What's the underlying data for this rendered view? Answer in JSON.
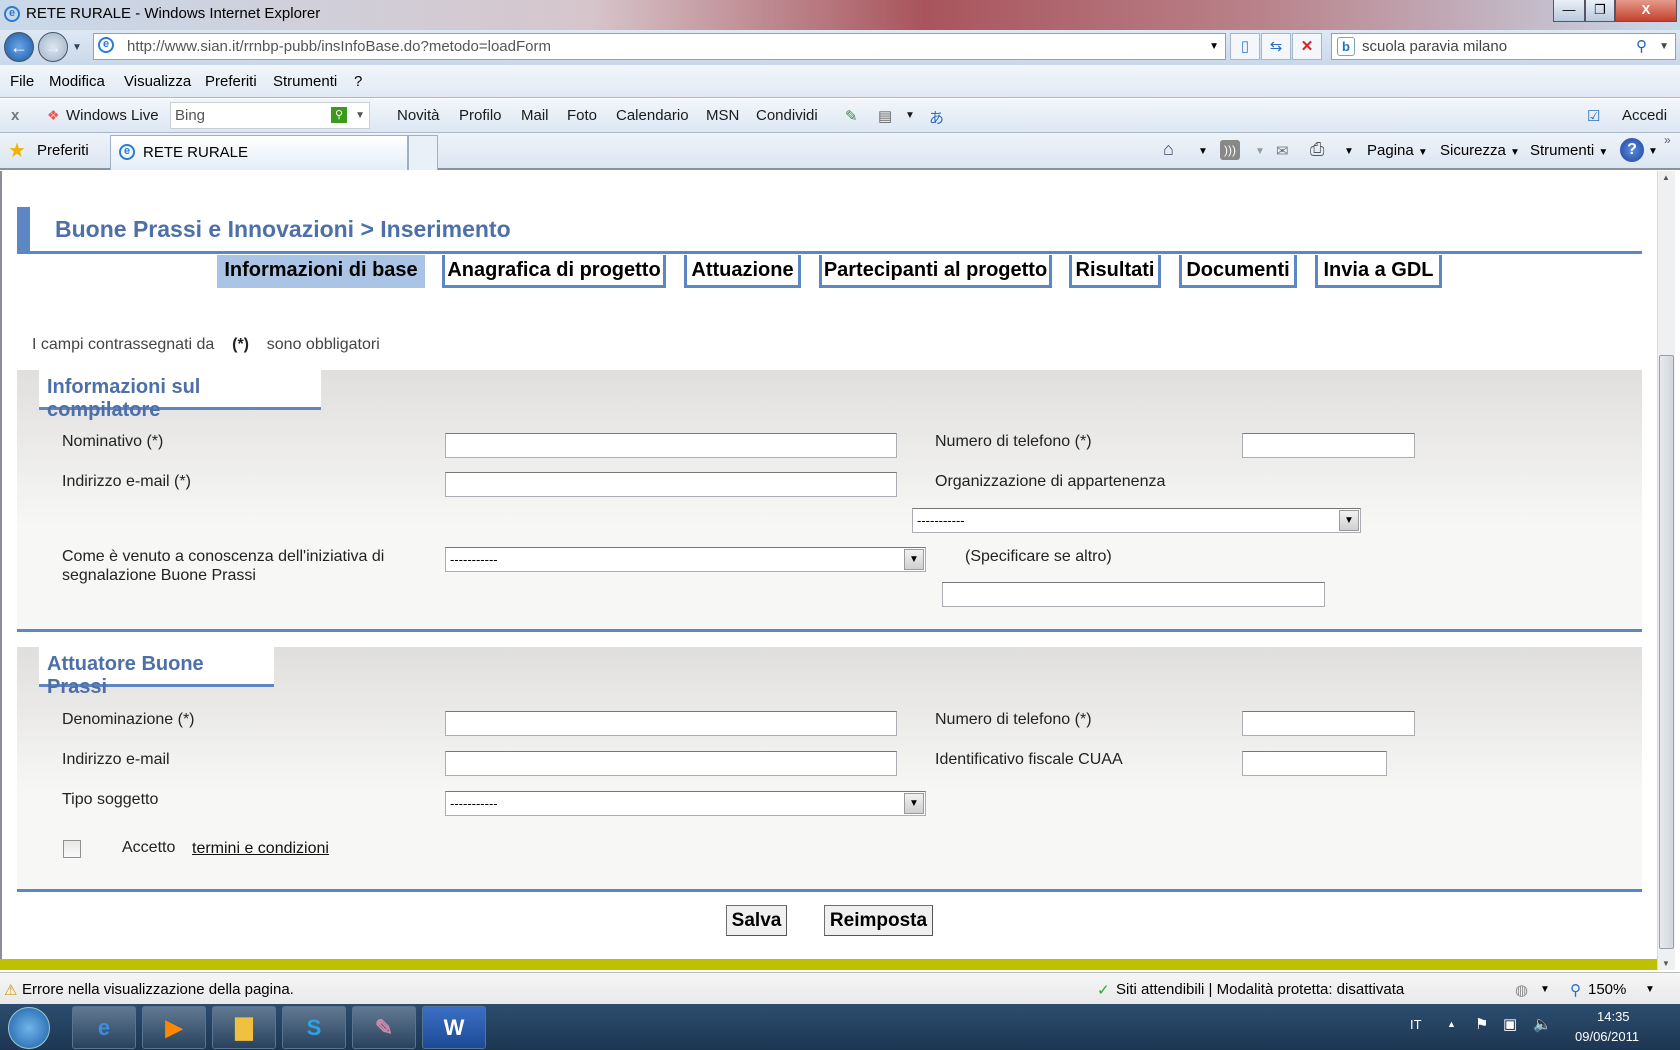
{
  "window": {
    "title": "RETE RURALE - Windows Internet Explorer",
    "minimize": "—",
    "restore": "❐",
    "close": "X"
  },
  "address": {
    "url": "http://www.sian.it/rrnbp-pubb/insInfoBase.do?metodo=loadForm",
    "search_value": "scuola paravia milano"
  },
  "menu": [
    "File",
    "Modifica",
    "Visualizza",
    "Preferiti",
    "Strumenti",
    "?"
  ],
  "live_toolbar": {
    "close": "x",
    "brand": "Windows Live",
    "search_placeholder": "Bing",
    "links": [
      "Novità",
      "Profilo",
      "Mail",
      "Foto",
      "Calendario",
      "MSN",
      "Condividi"
    ],
    "signin": "Accedi"
  },
  "favorites": {
    "label": "Preferiti",
    "tab_title": "RETE RURALE",
    "commands": [
      "Pagina",
      "Sicurezza",
      "Strumenti"
    ]
  },
  "page": {
    "title": "Buone Prassi e Innovazioni > Inserimento",
    "tabs": [
      {
        "label": "Informazioni di base",
        "active": true
      },
      {
        "label": "Anagrafica di progetto"
      },
      {
        "label": "Attuazione"
      },
      {
        "label": "Partecipanti al progetto"
      },
      {
        "label": "Risultati"
      },
      {
        "label": "Documenti"
      },
      {
        "label": "Invia a GDL"
      }
    ],
    "note": {
      "before": "I campi contrassegnati da",
      "mark": "(*)",
      "after": "sono obbligatori"
    },
    "compilatore": {
      "heading": "Informazioni sul compilatore",
      "nominativo": "Nominativo (*)",
      "telefono": "Numero di telefono (*)",
      "email": "Indirizzo e-mail  (*)",
      "organizzazione": "Organizzazione di appartenenza",
      "organizzazione_value": "-----------",
      "conoscenza_1": "Come è venuto a conoscenza dell'iniziativa di",
      "conoscenza_2": "segnalazione Buone Prassi",
      "conoscenza_value": "-----------",
      "specificare": "(Specificare se altro)"
    },
    "attuatore": {
      "heading": "Attuatore Buone Prassi",
      "denominazione": "Denominazione (*)",
      "telefono": "Numero di telefono (*)",
      "email": "Indirizzo e-mail",
      "cuaa": "Identificativo fiscale CUAA",
      "tipo": "Tipo soggetto",
      "tipo_value": "-----------",
      "accetto": "Accetto",
      "termini": "termini e condizioni"
    },
    "buttons": {
      "save": "Salva",
      "reset": "Reimposta"
    }
  },
  "status": {
    "error": "Errore nella visualizzazione della pagina.",
    "zone": "Siti attendibili | Modalità protetta: disattivata",
    "zoom": "150%"
  },
  "taskbar": {
    "lang": "IT",
    "time": "14:35",
    "date": "09/06/2011"
  },
  "colors": {
    "accent": "#5c87c4",
    "title": "#4d70a8",
    "active_tab": "#a9c4e4",
    "footer_bar": "#c1c000"
  }
}
